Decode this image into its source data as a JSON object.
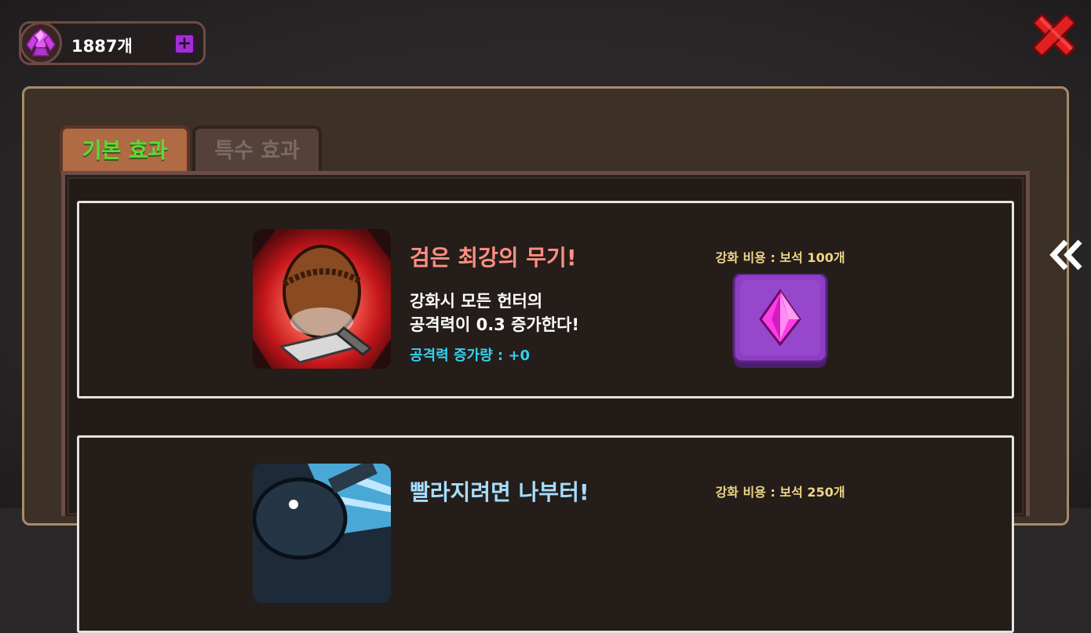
{
  "currency": {
    "count_label": "1887개",
    "icon": "pink-crystal-gem-icon",
    "add_label": "+"
  },
  "close_icon": "red-x-close-icon",
  "tabs": [
    {
      "label": "기본 효과",
      "active": true
    },
    {
      "label": "특수 효과",
      "active": false
    }
  ],
  "scroll_icon": "double-chevron-left-icon",
  "cards": [
    {
      "title": "검은 최강의 무기!",
      "desc_line1": "강화시 모든 헌터의",
      "desc_line2": "공격력이 0.3 증가한다!",
      "stat": "공격력 증가량 : +0",
      "cost": "강화 비용 : 보석 100개",
      "icon": "hunter-with-sword-icon",
      "upgrade_icon": "purple-gem-upgrade-button-icon"
    },
    {
      "title": "빨라지려면 나부터!",
      "cost": "강화 비용 : 보석 250개",
      "icon": "dashing-hunter-icon"
    }
  ],
  "colors": {
    "title_red": "#ff8f82",
    "stat_cyan": "#34d0f0",
    "cost_yellow": "#f0d68a",
    "tab_active_text": "#5ed837",
    "gem_purple": "#a22ed6"
  }
}
